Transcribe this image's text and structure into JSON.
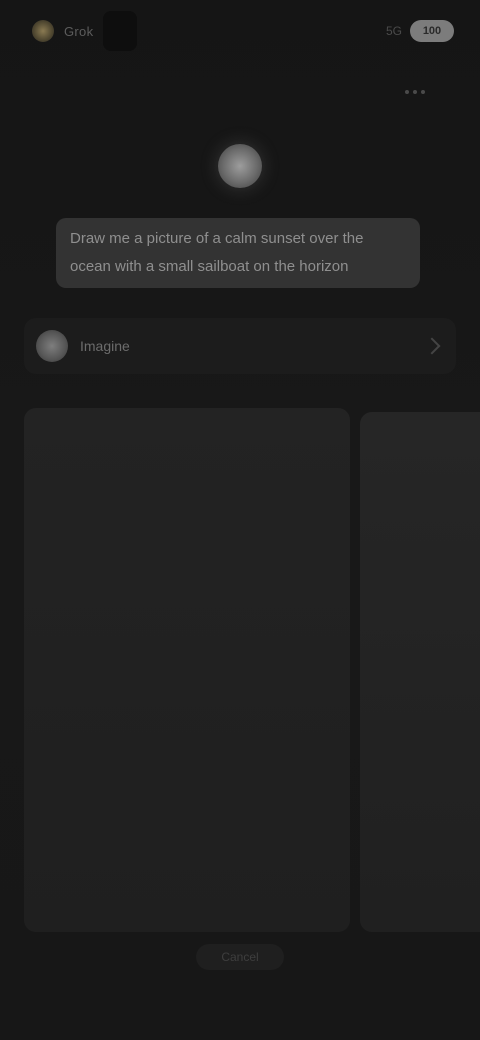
{
  "status_bar": {
    "app_label": "Grok",
    "right_text": "5G",
    "battery": "100"
  },
  "message": {
    "line1": "Draw me a picture of a calm sunset over the",
    "line2": "ocean with a small sailboat on the horizon"
  },
  "user": {
    "name": "Imagine"
  },
  "bottom": {
    "label": "Cancel"
  }
}
